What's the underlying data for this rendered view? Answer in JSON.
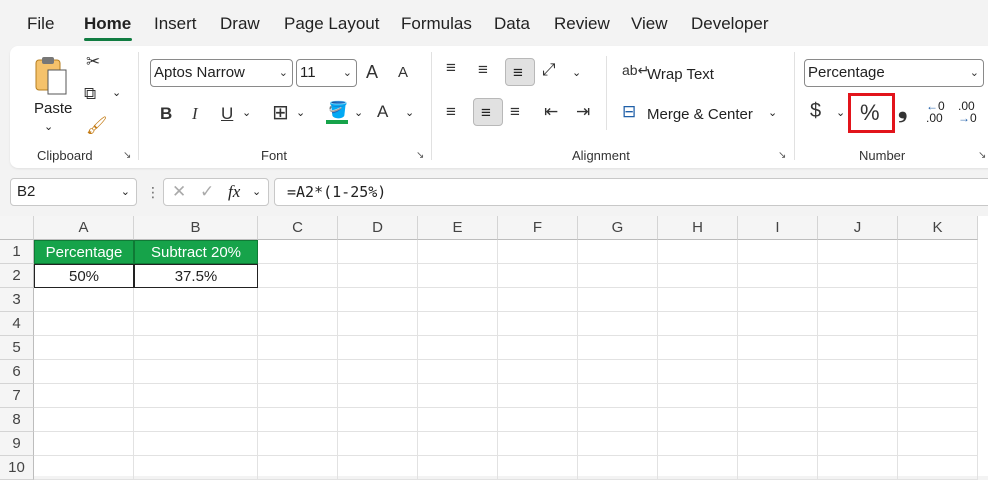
{
  "tabs": [
    "File",
    "Home",
    "Insert",
    "Draw",
    "Page Layout",
    "Formulas",
    "Data",
    "Review",
    "View",
    "Developer"
  ],
  "active_tab": "Home",
  "clipboard": {
    "paste_label": "Paste",
    "group_label": "Clipboard"
  },
  "font": {
    "name": "Aptos Narrow",
    "size": "11",
    "group_label": "Font",
    "bold": "B",
    "italic": "I",
    "underline": "U",
    "grow": "A",
    "shrink": "A",
    "font_color": "A"
  },
  "alignment": {
    "wrap_label": "Wrap Text",
    "merge_label": "Merge & Center",
    "group_label": "Alignment"
  },
  "number": {
    "format": "Percentage",
    "currency": "$",
    "percent": "%",
    "comma": "❟",
    "inc_decimal": ".00",
    "dec_decimal": ".00",
    "group_label": "Number"
  },
  "formula_bar": {
    "name_box": "B2",
    "fx": "fx",
    "formula": "=A2*(1-25%)"
  },
  "columns": [
    "A",
    "B",
    "C",
    "D",
    "E",
    "F",
    "G",
    "H",
    "I",
    "J",
    "K"
  ],
  "rows": [
    "1",
    "2",
    "3",
    "4",
    "5",
    "6",
    "7",
    "8",
    "9",
    "10"
  ],
  "cells": {
    "A1": "Percentage",
    "B1": "Subtract 20%",
    "A2": "50%",
    "B2": "37.5%"
  },
  "colors": {
    "accent": "#107c41",
    "header_fill": "#16a34a",
    "highlight": "#e2141b"
  }
}
